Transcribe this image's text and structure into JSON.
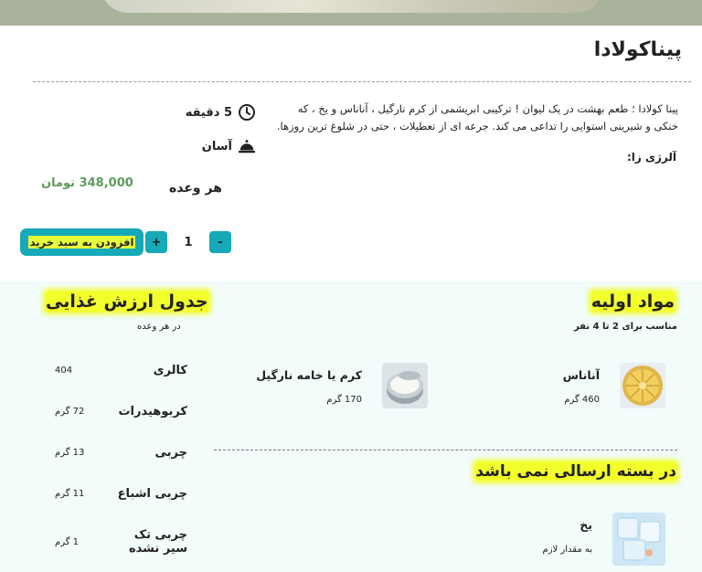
{
  "recipe": {
    "title": "پیناکولادا",
    "description": "پینا کولادا ؛ طعم بهشت در یک لیوان ! ترکیبی ابریشمی از کرم نارگیل ، آناناس و یخ ، که خنکی و شیرینی استوایی را تداعی می کند. جرعه ای از تعطیلات ، حتی در شلوغ ترین روزها.",
    "allergy_label": "آلرژی زا:",
    "time": "5 دقیقه",
    "difficulty": "آسان",
    "per_serving": "هر وعده",
    "price": "348,000 تومان"
  },
  "cart": {
    "add_label": "افزودن به سبد خرید",
    "plus": "+",
    "minus": "-",
    "quantity": "1"
  },
  "nutrition": {
    "title": "جدول ارزش غذایی",
    "subtitle": "در هر وعده",
    "rows": [
      {
        "name": "کالری",
        "value": "404"
      },
      {
        "name": "کربوهیدرات",
        "value": "72 گرم"
      },
      {
        "name": "چربی",
        "value": "13 گرم"
      },
      {
        "name": "چربی اشباع",
        "value": "11 گرم"
      },
      {
        "name": "چربی تک سیر نشده",
        "value": "1 گرم"
      }
    ]
  },
  "ingredients": {
    "title": "مواد اولیه",
    "subtitle": "مناسب برای 2 تا 4 نفر",
    "items": [
      {
        "name": "آناناس",
        "amount": "460 گرم",
        "icon": "pineapple-icon"
      },
      {
        "name": "کرم یا خامه نارگیل",
        "amount": "170 گرم",
        "icon": "coconut-cream-icon"
      }
    ]
  },
  "not_included": {
    "title": "در بسته ارسالی نمی باشد",
    "items": [
      {
        "name": "یخ",
        "amount": "به مقدار لازم",
        "icon": "ice-icon"
      }
    ]
  },
  "colors": {
    "accent": "#16a9b8",
    "highlight": "#f2ff2b",
    "price": "#5f9a5f",
    "panel": "#f1fcfb"
  }
}
